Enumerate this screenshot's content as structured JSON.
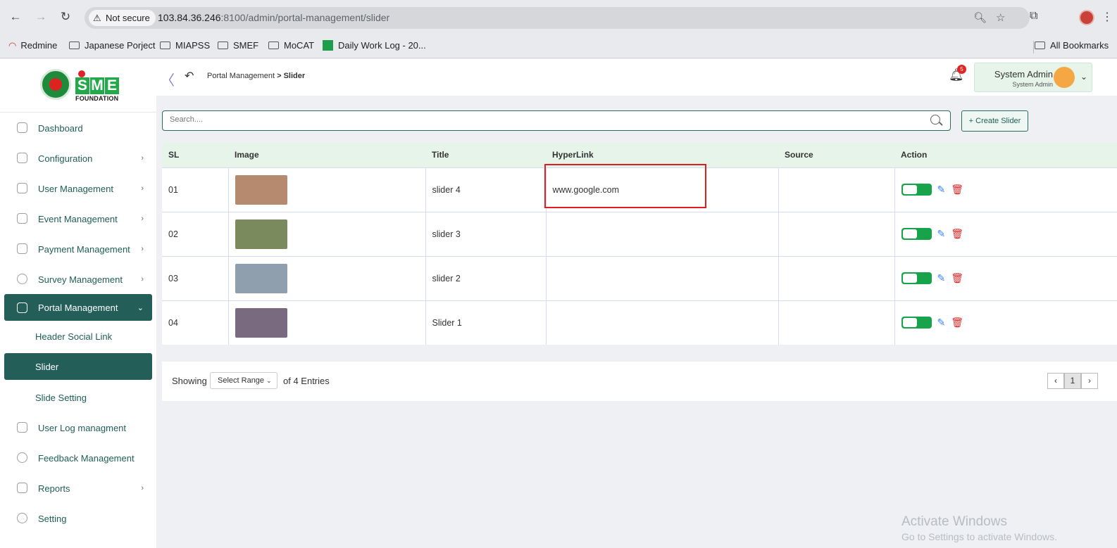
{
  "browser": {
    "security": "Not secure",
    "url_host": "103.84.36.246",
    "url_rest": ":8100/admin/portal-management/slider",
    "bookmarks": [
      "Redmine",
      "Japanese Porject",
      "MIAPSS",
      "SMEF",
      "MoCAT",
      "Daily Work Log - 20...",
      "All Bookmarks"
    ]
  },
  "logo": {
    "letters": [
      "S",
      "M",
      "E"
    ],
    "subtitle": "FOUNDATION"
  },
  "sidebar": {
    "items": [
      {
        "label": "Dashboard"
      },
      {
        "label": "Configuration",
        "chevron": "›"
      },
      {
        "label": "User Management",
        "chevron": "›"
      },
      {
        "label": "Event Management",
        "chevron": "›"
      },
      {
        "label": "Payment Management",
        "chevron": "›"
      },
      {
        "label": "Survey Management",
        "chevron": "›"
      },
      {
        "label": "Portal Management",
        "chevron": "⌄"
      },
      {
        "label": "Header Social Link"
      },
      {
        "label": "Slider"
      },
      {
        "label": "Slide Setting"
      },
      {
        "label": "User Log managment"
      },
      {
        "label": "Feedback Management"
      },
      {
        "label": "Reports",
        "chevron": "›"
      },
      {
        "label": "Setting"
      }
    ]
  },
  "topbar": {
    "breadcrumb_parent": "Portal Management",
    "breadcrumb_sep": ">",
    "breadcrumb_current": "Slider",
    "notif_count": "5",
    "user_name": "System Admin",
    "user_role": "System Admin"
  },
  "toolbar": {
    "search_placeholder": "Search....",
    "create_label": "Create Slider",
    "create_plus": "+"
  },
  "table": {
    "headers": [
      "SL",
      "Image",
      "Title",
      "HyperLink",
      "Source",
      "Action"
    ],
    "rows": [
      {
        "sl": "01",
        "title": "slider 4",
        "hyperlink": "www.google.com",
        "source": "",
        "thumb_color": "#b58a6e"
      },
      {
        "sl": "02",
        "title": "slider 3",
        "hyperlink": "",
        "source": "",
        "thumb_color": "#7b8a5c"
      },
      {
        "sl": "03",
        "title": "slider 2",
        "hyperlink": "",
        "source": "",
        "thumb_color": "#8f9fae"
      },
      {
        "sl": "04",
        "title": "Slider 1",
        "hyperlink": "",
        "source": "",
        "thumb_color": "#7a6a80"
      }
    ]
  },
  "pagination": {
    "showing": "Showing",
    "range": "Select Range",
    "of": "of 4 Entries",
    "current_page": "1",
    "prev": "‹",
    "next": "›"
  },
  "watermark": {
    "line1": "Activate Windows",
    "line2": "Go to Settings to activate Windows."
  },
  "colors": {
    "primary": "#235e58",
    "accent_green": "#16a34a",
    "highlight": "#e01e1e",
    "header_bg": "#e6f4ea"
  }
}
